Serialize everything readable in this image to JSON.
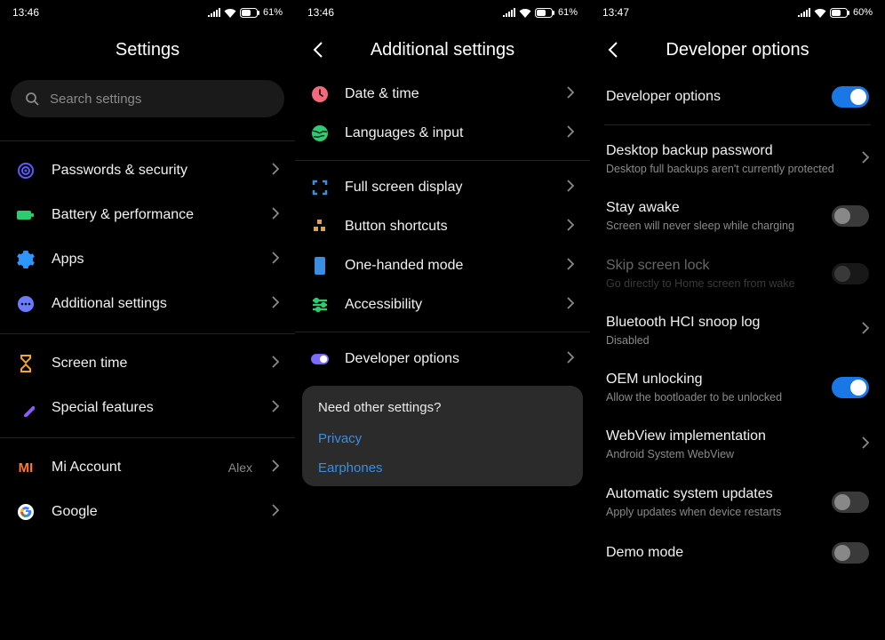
{
  "panes": [
    {
      "status": {
        "time": "13:46",
        "battery": "61"
      },
      "title": "Settings",
      "search_placeholder": "Search settings",
      "groups": [
        [
          {
            "key": "passwords",
            "label": "Passwords & security",
            "icon": "target",
            "color": "#5b5bff"
          },
          {
            "key": "battery",
            "label": "Battery & performance",
            "icon": "battery",
            "color": "#2ecc71"
          },
          {
            "key": "apps",
            "label": "Apps",
            "icon": "gear",
            "color": "#2e97ff"
          },
          {
            "key": "additional",
            "label": "Additional settings",
            "icon": "dots",
            "color": "#6b7bff"
          }
        ],
        [
          {
            "key": "screentime",
            "label": "Screen time",
            "icon": "hourglass",
            "color": "#f5a623"
          },
          {
            "key": "special",
            "label": "Special features",
            "icon": "wand",
            "color": "#8b5bff"
          }
        ],
        [
          {
            "key": "miaccount",
            "label": "Mi Account",
            "icon": "mi",
            "color": "#ff7a2f",
            "value": "Alex"
          },
          {
            "key": "google",
            "label": "Google",
            "icon": "google",
            "color": "#4285f4"
          }
        ]
      ]
    },
    {
      "status": {
        "time": "13:46",
        "battery": "61"
      },
      "title": "Additional settings",
      "groups": [
        [
          {
            "key": "datetime",
            "label": "Date & time",
            "icon": "clock",
            "color": "#f36a7b"
          },
          {
            "key": "languages",
            "label": "Languages & input",
            "icon": "globe",
            "color": "#2ecc71"
          }
        ],
        [
          {
            "key": "fullscreen",
            "label": "Full screen display",
            "icon": "corners",
            "color": "#3b8de0"
          },
          {
            "key": "shortcuts",
            "label": "Button shortcuts",
            "icon": "blocks",
            "color": "#e0a23b"
          },
          {
            "key": "onehanded",
            "label": "One-handed mode",
            "icon": "phone",
            "color": "#3b8de0"
          },
          {
            "key": "accessibility",
            "label": "Accessibility",
            "icon": "sliders",
            "color": "#2ecc71"
          }
        ],
        [
          {
            "key": "devoptions",
            "label": "Developer options",
            "icon": "toggle",
            "color": "#7b6bff"
          }
        ]
      ],
      "other": {
        "title": "Need other settings?",
        "links": [
          "Privacy",
          "Earphones"
        ]
      }
    },
    {
      "status": {
        "time": "13:47",
        "battery": "60"
      },
      "title": "Developer options",
      "first_toggle": {
        "key": "devopt",
        "title": "Developer options",
        "on": true
      },
      "items": [
        {
          "key": "backup",
          "title": "Desktop backup password",
          "sub": "Desktop full backups aren't currently protected",
          "type": "chev"
        },
        {
          "key": "stayawake",
          "title": "Stay awake",
          "sub": "Screen will never sleep while charging",
          "type": "toggle",
          "on": false
        },
        {
          "key": "skiplock",
          "title": "Skip screen lock",
          "sub": "Go directly to Home screen from wake",
          "type": "toggle",
          "on": false,
          "disabled": true
        },
        {
          "key": "bthci",
          "title": "Bluetooth HCI snoop log",
          "sub": "Disabled",
          "type": "chev"
        },
        {
          "key": "oem",
          "title": "OEM unlocking",
          "sub": "Allow the bootloader to be unlocked",
          "type": "toggle",
          "on": true
        },
        {
          "key": "webview",
          "title": "WebView implementation",
          "sub": "Android System WebView",
          "type": "chev"
        },
        {
          "key": "autoupd",
          "title": "Automatic system updates",
          "sub": "Apply updates when device restarts",
          "type": "toggle",
          "on": false
        },
        {
          "key": "demo",
          "title": "Demo mode",
          "type": "toggle",
          "on": false
        }
      ]
    }
  ]
}
